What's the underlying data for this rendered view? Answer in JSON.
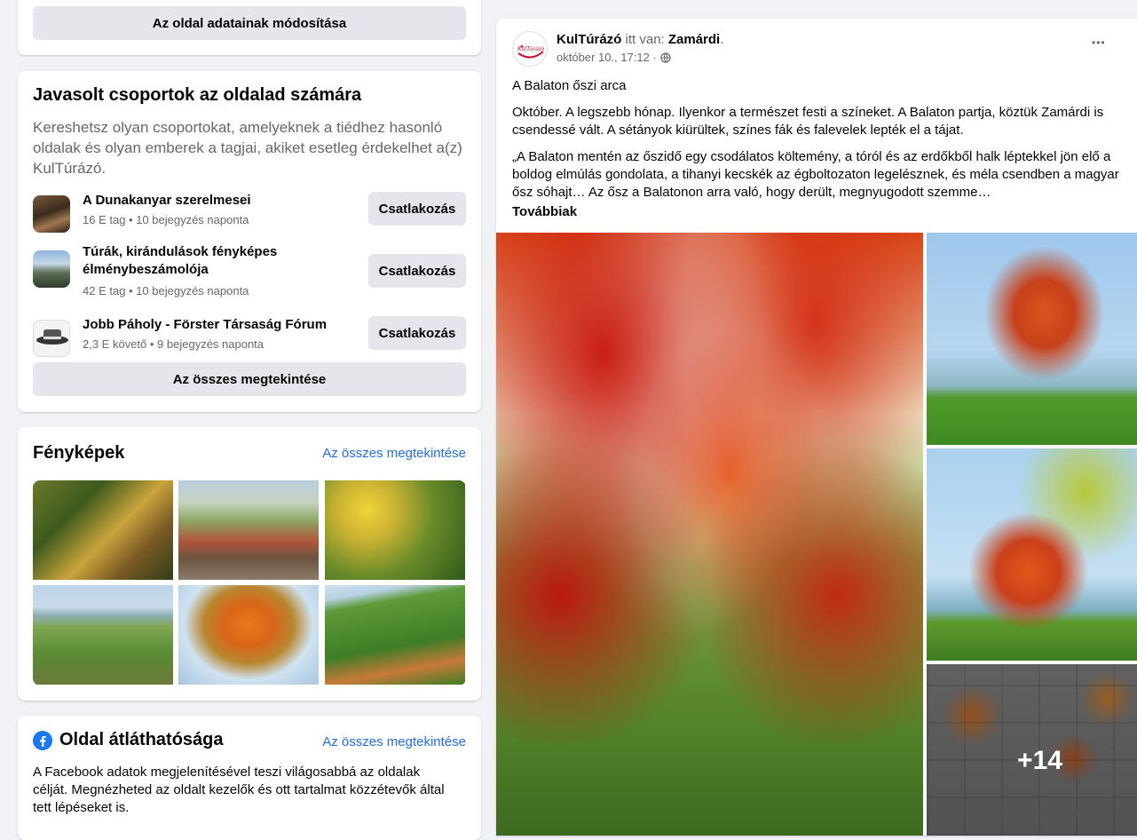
{
  "left": {
    "edit_page_button": "Az oldal adatainak módosítása",
    "suggested_groups": {
      "title": "Javasolt csoportok az oldalad számára",
      "description": "Kereshetsz olyan csoportokat, amelyeknek a tiédhez hasonló oldalak és olyan emberek a tagjai, akiket esetleg érdekelhet a(z) KulTúrázó.",
      "groups": [
        {
          "name": "A Dunakanyar szerelmesei",
          "meta": "16 E tag • 10 bejegyzés naponta",
          "action": "Csatlakozás"
        },
        {
          "name": "Túrák, kirándulások fényképes élménybeszámolója",
          "meta": "42 E tag • 10 bejegyzés naponta",
          "action": "Csatlakozás"
        },
        {
          "name": "Jobb Páholy - Förster Társaság Fórum",
          "meta": "2,3 E követő • 9 bejegyzés naponta",
          "action": "Csatlakozás"
        }
      ],
      "see_all": "Az összes megtekintése"
    },
    "photos": {
      "title": "Fényképek",
      "see_all": "Az összes megtekintése"
    },
    "transparency": {
      "title": "Oldal átláthatósága",
      "see_all": "Az összes megtekintése",
      "description": "A Facebook adatok megjelenítésével teszi világosabbá az oldalak célját. Megnézheted az oldalt kezelők és ott tartalmat közzétevők által tett lépéseket is."
    }
  },
  "post": {
    "page_name": "KulTúrázó",
    "location_prefix": " itt van: ",
    "location": "Zamárdi",
    "location_suffix": ".",
    "timestamp": "október 10., 17:12 ·",
    "more_label": "•••",
    "headline": "A Balaton őszi arca",
    "paragraph1": "Október. A legszebb hónap. Ilyenkor a természet festi a színeket. A Balaton partja, köztük Zamárdi is csendessé vált. A sétányok kiürültek, színes fák és falevelek lepték el a tájat.",
    "paragraph2": "„A Balaton mentén az őszidő egy csodálatos költemény, a tóról és az erdőkből halk léptekkel jön elő a boldog elmúlás gondolata, a tihanyi kecskék az égboltozaton legelésznek, és méla csendben a magyar ősz sóhajt… Az ősz a Balatonon arra való, hogy derült, megnyugodott szemme…",
    "see_more": "Továbbiak",
    "more_photos_count": "+14",
    "logo_text": "KulTúrázó"
  },
  "colors": {
    "link": "#216fdb",
    "background": "#f0f2f5",
    "button_gray": "#e4e6eb",
    "facebook_blue": "#1877f2"
  }
}
